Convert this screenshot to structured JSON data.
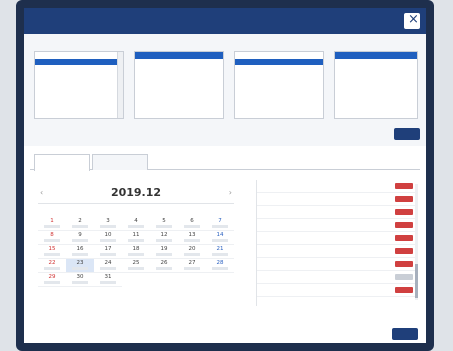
{
  "window": {
    "title": ""
  },
  "filters": {
    "columns": [
      {
        "label": "",
        "items": [
          "",
          "",
          "",
          "",
          "",
          "",
          "",
          "",
          ""
        ],
        "selected_index": 1
      },
      {
        "label": "",
        "items": [
          "",
          ""
        ],
        "selected_index": 0
      },
      {
        "label": "",
        "items": [
          "",
          ""
        ],
        "selected_index": 1
      },
      {
        "label": "",
        "items": [
          "",
          "",
          "",
          "",
          "",
          ""
        ],
        "selected_index": 0
      }
    ],
    "note": ""
  },
  "tabs": [
    {
      "label": ""
    },
    {
      "label": ""
    }
  ],
  "calendar": {
    "title": "2019.12",
    "weekdays": [
      "",
      "",
      "",
      "",
      "",
      "",
      ""
    ],
    "days": [
      "1",
      "2",
      "3",
      "4",
      "5",
      "6",
      "7",
      "8",
      "9",
      "10",
      "11",
      "12",
      "13",
      "14",
      "15",
      "16",
      "17",
      "18",
      "19",
      "20",
      "21",
      "22",
      "23",
      "24",
      "25",
      "26",
      "27",
      "28",
      "29",
      "30",
      "31"
    ],
    "first_weekday_index": 0,
    "today_index": 22
  },
  "slots": [
    {
      "prefix": "",
      "num": "",
      "time": "",
      "status_muted": false
    },
    {
      "prefix": "",
      "num": "",
      "time": "",
      "status_muted": false
    },
    {
      "prefix": "",
      "num": "",
      "time": "",
      "status_muted": false
    },
    {
      "prefix": "",
      "num": "",
      "time": "",
      "status_muted": false
    },
    {
      "prefix": "",
      "num": "",
      "time": "",
      "status_muted": false
    },
    {
      "prefix": "",
      "num": "",
      "time": "",
      "status_muted": false
    },
    {
      "prefix": "",
      "num": "",
      "time": "",
      "status_muted": false
    },
    {
      "prefix": "",
      "num": "",
      "time": "",
      "status_muted": true
    },
    {
      "prefix": "",
      "num": "",
      "time": "",
      "status_muted": false
    }
  ],
  "colors": {
    "titlebar": "#1f3f7a",
    "selection": "#1f5fbf",
    "status": "#d04040"
  },
  "icons": {
    "close": "close-icon",
    "prev": "chevron-left-icon",
    "next": "chevron-right-icon"
  }
}
